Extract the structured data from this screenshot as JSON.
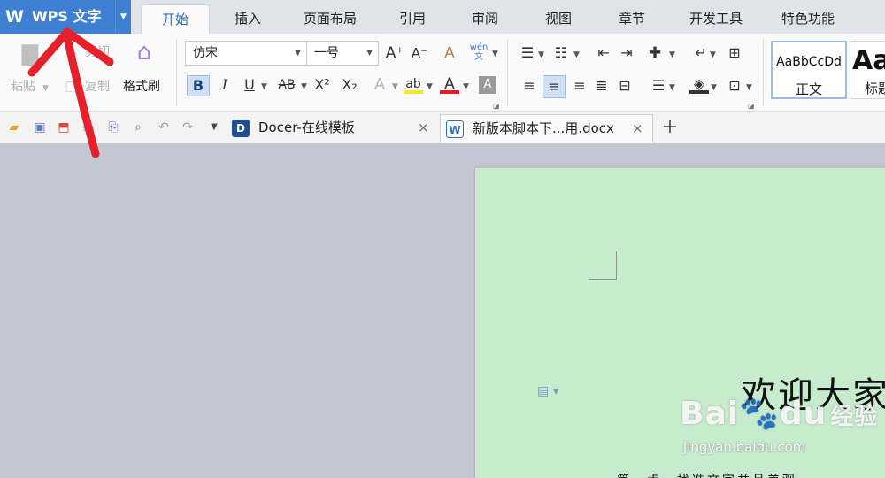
{
  "app": {
    "logo": "W",
    "name": "WPS 文字",
    "dropdown": "▼"
  },
  "menu": {
    "tabs": [
      "开始",
      "插入",
      "页面布局",
      "引用",
      "审阅",
      "视图",
      "章节",
      "开发工具",
      "特色功能"
    ],
    "active_tab": "开始"
  },
  "ribbon": {
    "clipboard": {
      "paste": "粘贴",
      "cut": "剪切",
      "copy": "复制",
      "format_painter": "格式刷"
    },
    "font": {
      "family": "仿宋",
      "size": "一号",
      "bold": "B",
      "italic": "I",
      "underline": "U",
      "strike": "AB",
      "superscript": "X²",
      "subscript": "X₂",
      "text_effect": "A",
      "highlight": "ab",
      "font_color": "A",
      "char_shade": "A",
      "grow": "A⁺",
      "shrink": "A⁻",
      "clear": "A",
      "phonetic": "wén 文"
    },
    "styles": [
      {
        "sample": "AaBbCcDd",
        "name": "正文"
      },
      {
        "sample": "Aa",
        "name": "标题"
      }
    ]
  },
  "quick_access": {
    "icons": [
      "open-icon",
      "save-icon",
      "pdf-icon",
      "print-icon",
      "print-preview-icon",
      "find-icon",
      "undo-icon",
      "redo-icon",
      "customize-icon"
    ]
  },
  "document_tabs": [
    {
      "title": "Docer-在线模板",
      "close": "×",
      "icon": "D"
    },
    {
      "title": "新版本脚本下...用.docx",
      "close": "×",
      "icon": "W"
    }
  ],
  "new_tab": "+",
  "document": {
    "heading": "欢迎大家",
    "line2": "第一步、找准文字并且美观"
  },
  "watermark": {
    "logo": "Bai",
    "logo_paw": "du",
    "brand": "经验",
    "url": "jingyan.baidu.com"
  },
  "colors": {
    "accent": "#3e7fd1",
    "page_bg": "#c7ebcd",
    "workspace": "#c4c6d2",
    "annotation": "#e6202a"
  }
}
